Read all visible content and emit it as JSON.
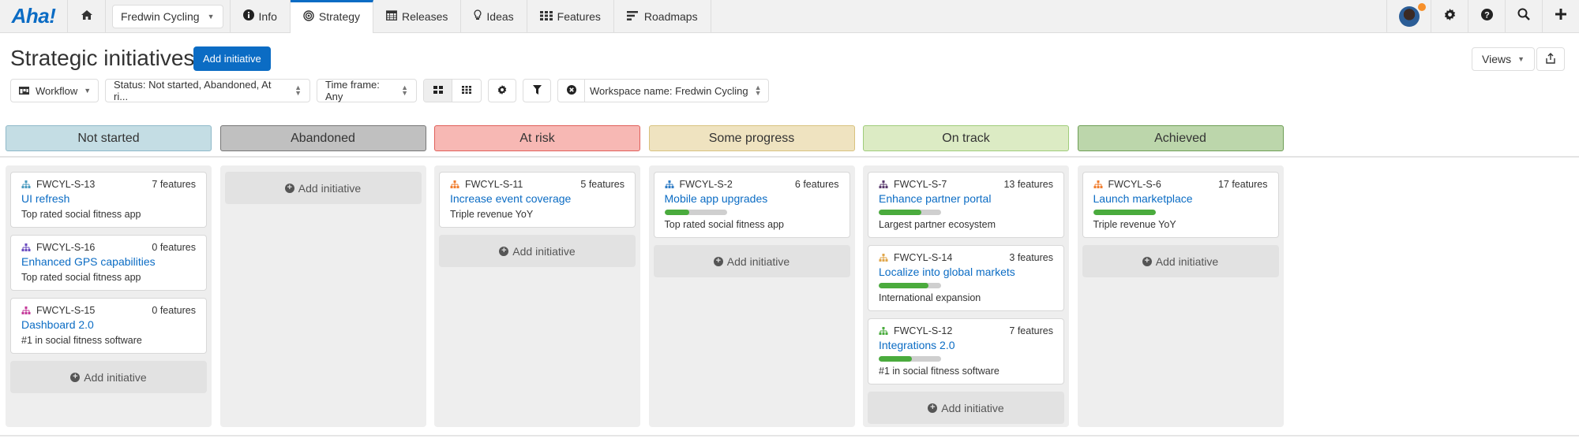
{
  "nav": {
    "logo": "Aha!",
    "workspace": "Fredwin Cycling",
    "items": [
      {
        "label": "Info",
        "icon": "info-icon"
      },
      {
        "label": "Strategy",
        "icon": "target-icon",
        "active": true
      },
      {
        "label": "Releases",
        "icon": "calendar-icon"
      },
      {
        "label": "Ideas",
        "icon": "lightbulb-icon"
      },
      {
        "label": "Features",
        "icon": "grid-icon"
      },
      {
        "label": "Roadmaps",
        "icon": "roadmap-icon"
      }
    ],
    "notification_color": "#f7902a"
  },
  "page": {
    "title": "Strategic initiatives",
    "add_button": "Add initiative",
    "views_button": "Views"
  },
  "filters": {
    "view_mode": "Workflow",
    "status": "Status: Not started, Abandoned, At ri...",
    "time_frame": "Time frame: Any",
    "workspace": "Workspace name: Fredwin Cycling"
  },
  "add_label": "Add initiative",
  "columns": [
    {
      "name": "Not started",
      "bg": "#c4dde4",
      "border": "#8fb9c9",
      "cards": [
        {
          "id": "FWCYL-S-13",
          "features": "7 features",
          "title": "UI refresh",
          "goal": "Top rated social fitness app",
          "icon_color": "#4a9bbf"
        },
        {
          "id": "FWCYL-S-16",
          "features": "0 features",
          "title": "Enhanced GPS capabilities",
          "goal": "Top rated social fitness app",
          "icon_color": "#6a4bbf"
        },
        {
          "id": "FWCYL-S-15",
          "features": "0 features",
          "title": "Dashboard 2.0",
          "goal": "#1 in social fitness software",
          "icon_color": "#c43a9a"
        }
      ]
    },
    {
      "name": "Abandoned",
      "bg": "#c0c0c0",
      "border": "#777777",
      "cards": []
    },
    {
      "name": "At risk",
      "bg": "#f7b8b4",
      "border": "#e0605a",
      "cards": [
        {
          "id": "FWCYL-S-11",
          "features": "5 features",
          "title": "Increase event coverage",
          "goal": "Triple revenue YoY",
          "icon_color": "#f07d2e"
        }
      ]
    },
    {
      "name": "Some progress",
      "bg": "#efe3c0",
      "border": "#d8c27f",
      "cards": [
        {
          "id": "FWCYL-S-2",
          "features": "6 features",
          "title": "Mobile app upgrades",
          "goal": "Top rated social fitness app",
          "icon_color": "#2e7bc4",
          "progress": 0.4
        }
      ]
    },
    {
      "name": "On track",
      "bg": "#dcebc4",
      "border": "#9fcc7a",
      "cards": [
        {
          "id": "FWCYL-S-7",
          "features": "13 features",
          "title": "Enhance partner portal",
          "goal": "Largest partner ecosystem",
          "icon_color": "#5a3b6e",
          "progress": 0.68
        },
        {
          "id": "FWCYL-S-14",
          "features": "3 features",
          "title": "Localize into global markets",
          "goal": "International expansion",
          "icon_color": "#e0a64a",
          "progress": 0.8
        },
        {
          "id": "FWCYL-S-12",
          "features": "7 features",
          "title": "Integrations 2.0",
          "goal": "#1 in social fitness software",
          "icon_color": "#4aab3d",
          "progress": 0.53
        }
      ]
    },
    {
      "name": "Achieved",
      "bg": "#bcd6ab",
      "border": "#6e9e55",
      "cards": [
        {
          "id": "FWCYL-S-6",
          "features": "17 features",
          "title": "Launch marketplace",
          "goal": "Triple revenue YoY",
          "icon_color": "#f07d2e",
          "progress": 1.0
        }
      ]
    }
  ]
}
